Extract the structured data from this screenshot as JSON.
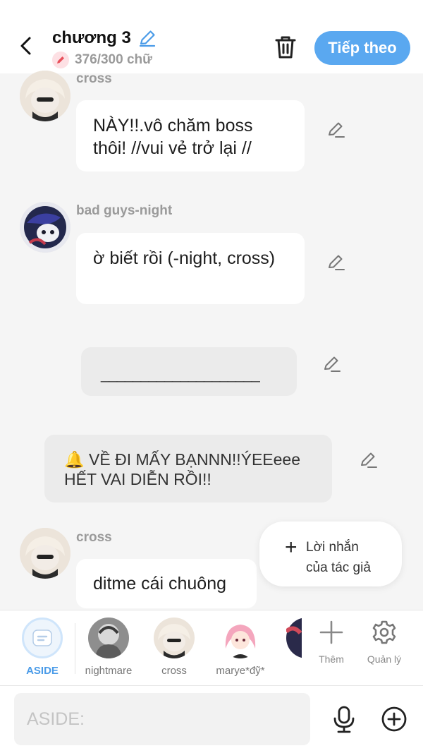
{
  "header": {
    "title": "chương 3",
    "word_count": "376/300 chữ",
    "next_label": "Tiếp theo"
  },
  "messages": [
    {
      "name": "cross",
      "text": "NÀY!!.vô chăm boss thôi! //vui vẻ trở lại //"
    },
    {
      "name": "bad guys-night",
      "text": "ờ biết rồi (-night, cross)"
    },
    {
      "name": "cross",
      "text": "ditme cái chuông"
    }
  ],
  "asides": [
    {
      "text": "____________________"
    },
    {
      "text": "🔔 VỀ ĐI MẤY BẠNNN!!ÝEEeee HẾT VAI DIỄN RỒI!!"
    }
  ],
  "author_note": {
    "label": "Lời nhắn của tác giả"
  },
  "characters": [
    {
      "label": "ASIDE"
    },
    {
      "label": "nightmare"
    },
    {
      "label": "cross"
    },
    {
      "label": "marye*đỹ*"
    }
  ],
  "tools": {
    "add_label": "Thêm",
    "manage_label": "Quản lý"
  },
  "input": {
    "placeholder": "ASIDE:"
  },
  "colors": {
    "accent": "#5aa8f0",
    "bubble": "#ffffff",
    "aside": "#ebebeb",
    "background": "#f5f5f5"
  }
}
